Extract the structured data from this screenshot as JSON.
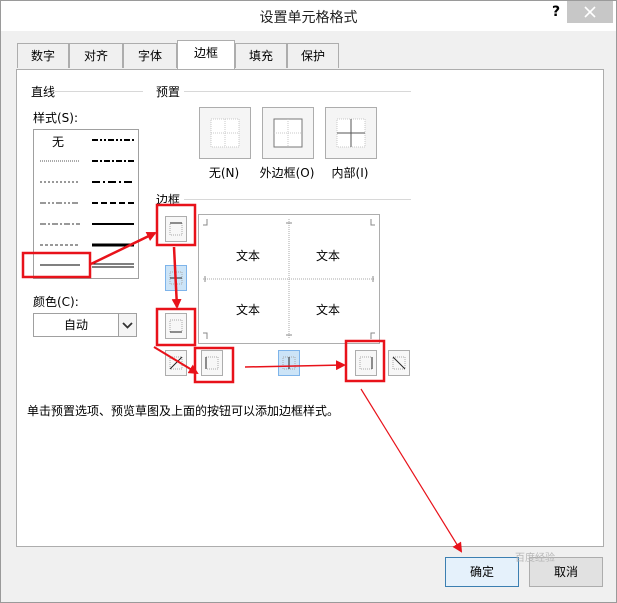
{
  "window": {
    "title": "设置单元格格式",
    "help": "?"
  },
  "tabs": [
    "数字",
    "对齐",
    "字体",
    "边框",
    "填充",
    "保护"
  ],
  "line_group": {
    "label": "直线",
    "style_label": "样式(S):",
    "style_none": "无",
    "color_label": "颜色(C):",
    "color_value": "自动"
  },
  "presets": {
    "label": "预置",
    "items": [
      "无(N)",
      "外边框(O)",
      "内部(I)"
    ]
  },
  "border": {
    "label": "边框",
    "preview_text": [
      "文本",
      "文本",
      "文本",
      "文本"
    ]
  },
  "hint": "单击预置选项、预览草图及上面的按钮可以添加边框样式。",
  "buttons": {
    "ok": "确定",
    "cancel": "取消"
  },
  "watermark": "百度经验",
  "colors": {
    "annotation": "#e8121a",
    "selected": "#cce4f7"
  }
}
